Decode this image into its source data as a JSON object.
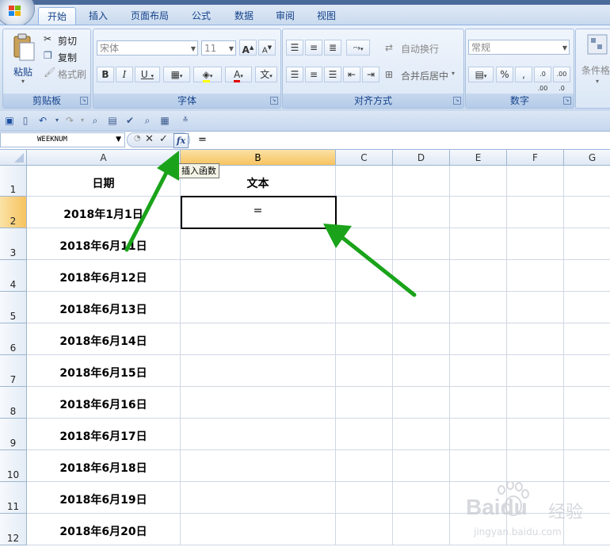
{
  "tabs": [
    "开始",
    "插入",
    "页面布局",
    "公式",
    "数据",
    "审阅",
    "视图"
  ],
  "active_tab": "开始",
  "ribbon": {
    "clipboard": {
      "paste": "粘贴",
      "cut": "剪切",
      "copy": "复制",
      "format_painter": "格式刷",
      "label": "剪贴板"
    },
    "font": {
      "font_name": "宋体",
      "font_size": "11",
      "grow": "A",
      "shrink": "A",
      "bold": "B",
      "italic": "I",
      "underline": "U",
      "font_color": "A",
      "phonetic": "文",
      "label": "字体"
    },
    "alignment": {
      "wrap_text": "自动换行",
      "merge_center": "合并后居中",
      "label": "对齐方式"
    },
    "number": {
      "format": "常规",
      "percent": "%",
      "comma": ",",
      "label": "数字"
    },
    "styles": {
      "conditional": "条件格式"
    }
  },
  "formula_bar": {
    "name_box": "WEEKNUM",
    "formula": "=",
    "cancel": "✕",
    "enter": "✓",
    "fx": "fx"
  },
  "tooltip": "插入函数",
  "columns": [
    "A",
    "B",
    "C",
    "D",
    "E",
    "F",
    "G"
  ],
  "rows": [
    {
      "num": "1",
      "a": "日期",
      "b": "文本"
    },
    {
      "num": "2",
      "a": "2018年1月1日",
      "b": "="
    },
    {
      "num": "3",
      "a": "2018年6月11日",
      "b": ""
    },
    {
      "num": "4",
      "a": "2018年6月12日",
      "b": ""
    },
    {
      "num": "5",
      "a": "2018年6月13日",
      "b": ""
    },
    {
      "num": "6",
      "a": "2018年6月14日",
      "b": ""
    },
    {
      "num": "7",
      "a": "2018年6月15日",
      "b": ""
    },
    {
      "num": "8",
      "a": "2018年6月16日",
      "b": ""
    },
    {
      "num": "9",
      "a": "2018年6月17日",
      "b": ""
    },
    {
      "num": "10",
      "a": "2018年6月18日",
      "b": ""
    },
    {
      "num": "11",
      "a": "2018年6月19日",
      "b": ""
    },
    {
      "num": "12",
      "a": "2018年6月20日",
      "b": ""
    }
  ],
  "active_cell": "B2",
  "watermark": {
    "brand": "Baidu",
    "cn": "经验",
    "url": "jingyan.baidu.com"
  },
  "colors": {
    "arrow": "#1aa31a",
    "selected_header": "#f7c35f",
    "ribbon": "#d7e4f3"
  }
}
